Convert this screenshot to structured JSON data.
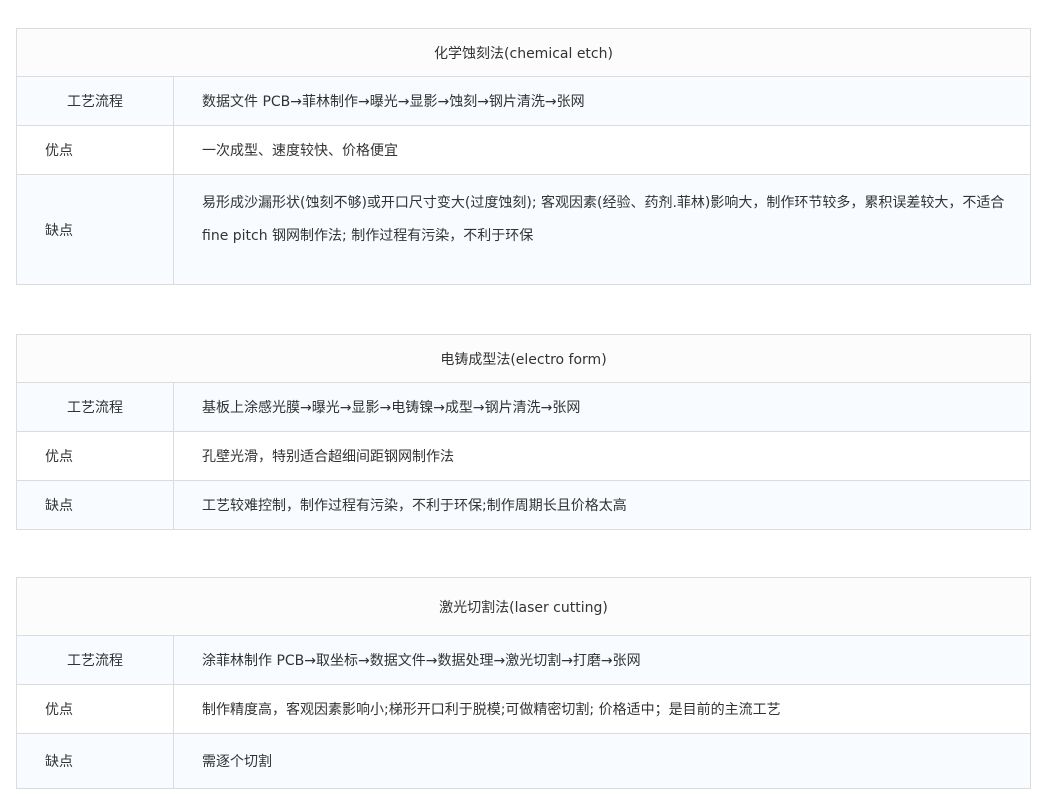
{
  "tables": [
    {
      "title": "化学蚀刻法(chemical etch)",
      "rows": [
        {
          "label": "工艺流程",
          "value": "数据文件 PCB→菲林制作→曝光→显影→蚀刻→钢片清洗→张网"
        },
        {
          "label": "优点",
          "value": "一次成型、速度较快、价格便宜"
        },
        {
          "label": "缺点",
          "value": "易形成沙漏形状(蚀刻不够)或开口尺寸变大(过度蚀刻); 客观因素(经验、药剂.菲林)影响大，制作环节较多，累积误差较大，不适合 fine pitch 钢网制作法; 制作过程有污染，不利于环保"
        }
      ]
    },
    {
      "title": "电铸成型法(electro form)",
      "rows": [
        {
          "label": "工艺流程",
          "value": "基板上涂感光膜→曝光→显影→电铸镍→成型→钢片清洗→张网"
        },
        {
          "label": "优点",
          "value": "孔壁光滑，特别适合超细间距钢网制作法"
        },
        {
          "label": "缺点",
          "value": "工艺较难控制，制作过程有污染，不利于环保;制作周期长且价格太高"
        }
      ]
    },
    {
      "title": "激光切割法(laser cutting)",
      "rows": [
        {
          "label": "工艺流程",
          "value": "涂菲林制作 PCB→取坐标→数据文件→数据处理→激光切割→打磨→张网"
        },
        {
          "label": "优点",
          "value": "制作精度高，客观因素影响小;梯形开口利于脱模;可做精密切割; 价格适中；是目前的主流工艺"
        },
        {
          "label": "缺点",
          "value": "需逐个切割"
        }
      ]
    }
  ]
}
